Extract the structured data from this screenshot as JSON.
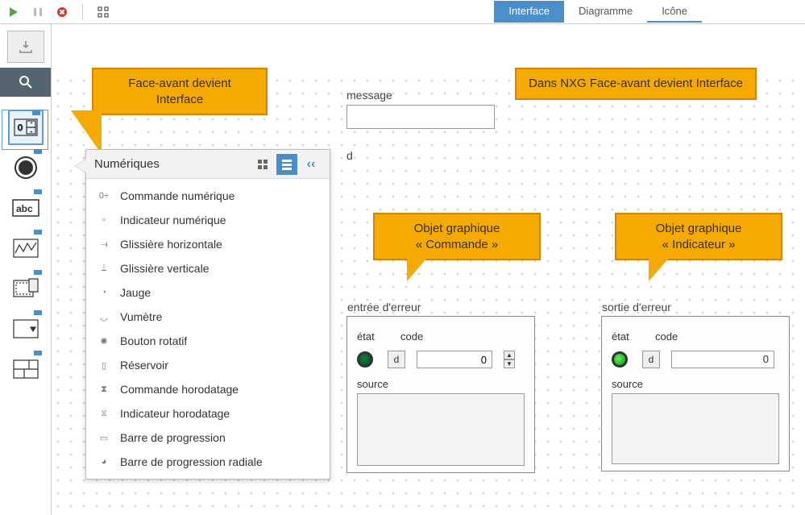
{
  "toolbar": {
    "run": "run-icon",
    "pause": "pause-icon",
    "abort": "abort-icon",
    "highlight": "highlight-icon"
  },
  "tabs": {
    "interface": "Interface",
    "diagram": "Diagramme",
    "icon": "Icône"
  },
  "callouts": {
    "c1": "Face-avant devient Interface",
    "c2": "Dans NXG Face-avant devient Interface",
    "c3_l1": "Objet graphique",
    "c3_l2": "« Commande »",
    "c4_l1": "Objet graphique",
    "c4_l2": "« Indicateur »"
  },
  "palette_panel": {
    "title": "Numériques",
    "items": [
      "Commande numérique",
      "Indicateur numérique",
      "Glissière horizontale",
      "Glissière verticale",
      "Jauge",
      "Vumètre",
      "Bouton rotatif",
      "Réservoir",
      "Commande horodatage",
      "Indicateur horodatage",
      "Barre de progression",
      "Barre de progression radiale"
    ]
  },
  "panel_labels": {
    "message": "message",
    "d": "d",
    "error_in": "entrée d'erreur",
    "error_out": "sortie d'erreur",
    "etat": "état",
    "code": "code",
    "source": "source",
    "d_small": "d",
    "code_val_in": "0",
    "code_val_out": "0"
  }
}
